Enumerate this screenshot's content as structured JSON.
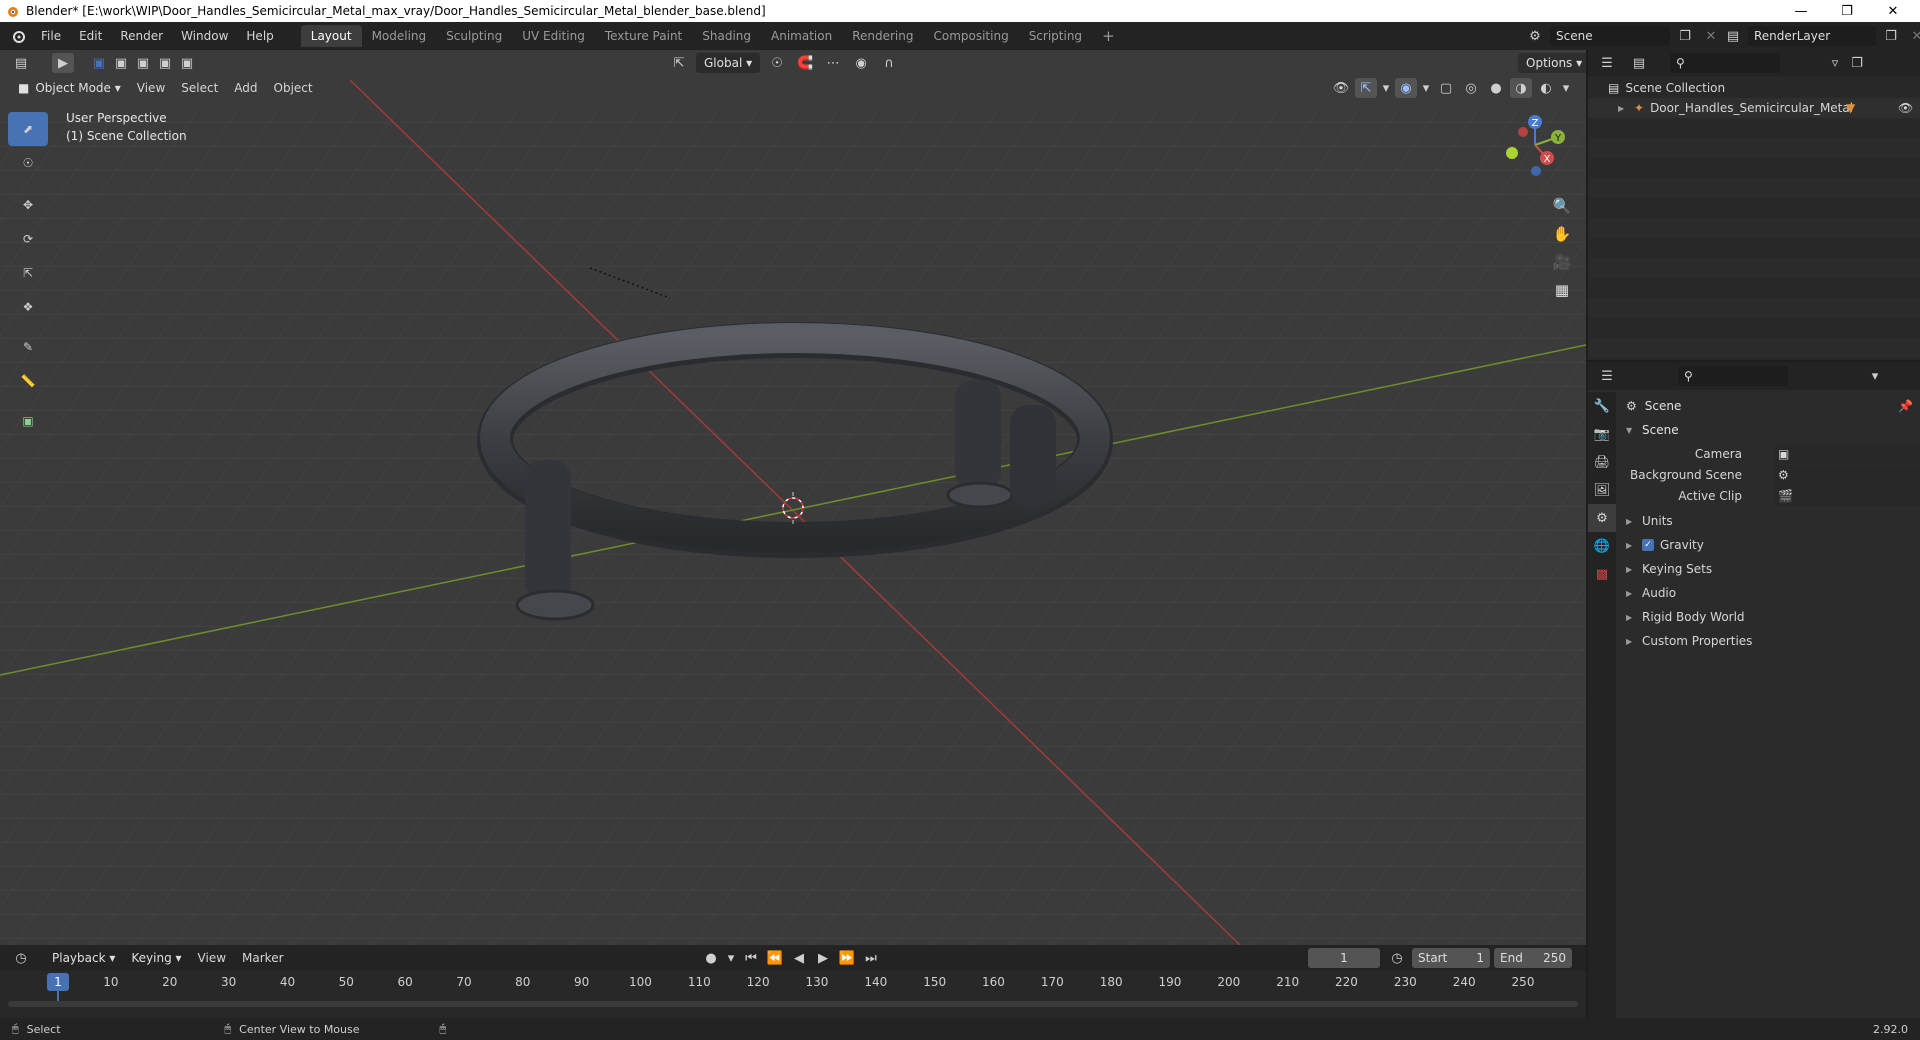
{
  "window": {
    "title": "Blender* [E:\\work\\WIP\\Door_Handles_Semicircular_Metal_max_vray/Door_Handles_Semicircular_Metal_blender_base.blend]"
  },
  "menu": [
    "File",
    "Edit",
    "Render",
    "Window",
    "Help"
  ],
  "workspaces": [
    "Layout",
    "Modeling",
    "Sculpting",
    "UV Editing",
    "Texture Paint",
    "Shading",
    "Animation",
    "Rendering",
    "Compositing",
    "Scripting"
  ],
  "active_workspace": "Layout",
  "scene_selector": "Scene",
  "renderlayer_selector": "RenderLayer",
  "viewport": {
    "transform_orientation": "Global",
    "options_label": "Options",
    "mode": "Object Mode",
    "menus": [
      "View",
      "Select",
      "Add",
      "Object"
    ],
    "overlay_line1": "User Perspective",
    "overlay_line2": "(1) Scene Collection",
    "gizmo_axes": [
      "Z",
      "Y",
      "X"
    ]
  },
  "outliner": {
    "root": "Scene Collection",
    "items": [
      {
        "label": "Door_Handles_Semicircular_Metal"
      }
    ]
  },
  "properties": {
    "context": "Scene",
    "panel": "Scene",
    "fields": [
      {
        "label": "Camera"
      },
      {
        "label": "Background Scene"
      },
      {
        "label": "Active Clip"
      }
    ],
    "subpanels": [
      "Units",
      "Gravity",
      "Keying Sets",
      "Audio",
      "Rigid Body World",
      "Custom Properties"
    ],
    "gravity_checked": true
  },
  "timeline": {
    "menus": [
      "Playback",
      "Keying",
      "View",
      "Marker"
    ],
    "current_frame": "1",
    "start_label": "Start",
    "start_value": "1",
    "end_label": "End",
    "end_value": "250",
    "ticks": [
      "1",
      "10",
      "20",
      "30",
      "40",
      "50",
      "60",
      "70",
      "80",
      "90",
      "100",
      "110",
      "120",
      "130",
      "140",
      "150",
      "160",
      "170",
      "180",
      "190",
      "200",
      "210",
      "220",
      "230",
      "240",
      "250"
    ]
  },
  "statusbar": {
    "left": "Select",
    "middle": "Center View to Mouse",
    "version": "2.92.0"
  },
  "colors": {
    "accent": "#4772b3",
    "x_axis": "#a33a3a",
    "y_axis": "#6d8f2a",
    "object_orange": "#e0903a"
  }
}
